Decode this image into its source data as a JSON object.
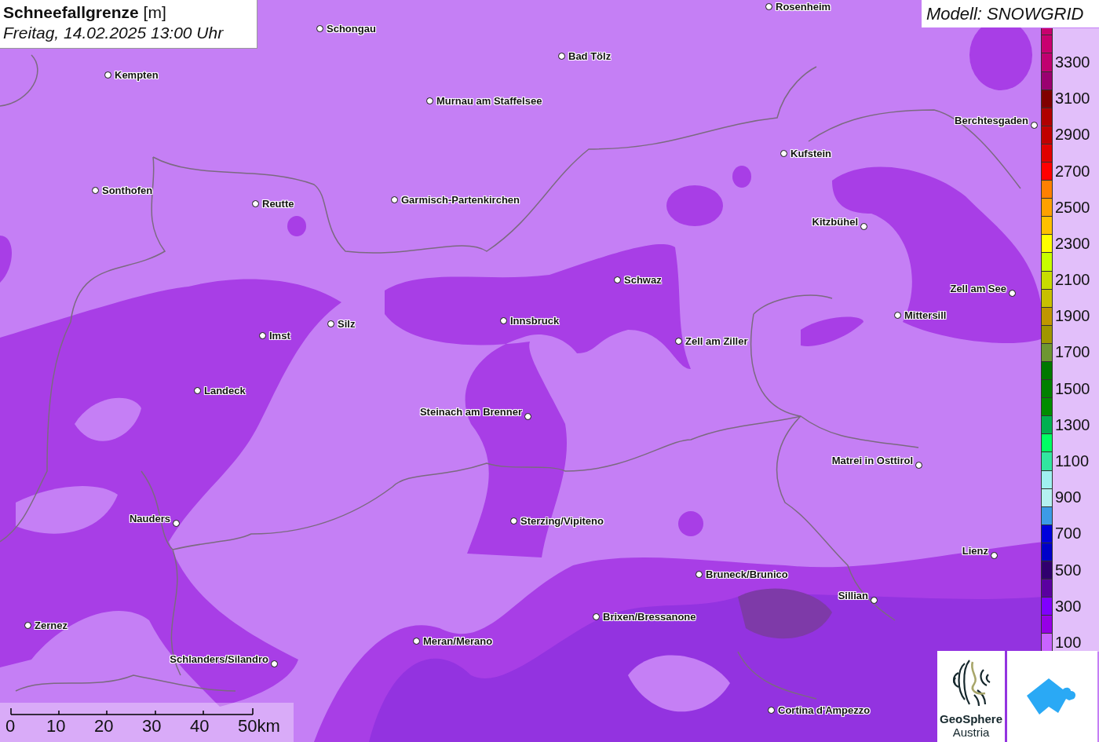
{
  "title": {
    "parameter": "Schneefallgrenze",
    "unit": "[m]",
    "datetime": "Freitag, 14.02.2025 13:00 Uhr"
  },
  "model_label": "Modell: SNOWGRID",
  "cities": [
    {
      "name": "Rosenheim"
    },
    {
      "name": "Schongau"
    },
    {
      "name": "Bad Tölz"
    },
    {
      "name": "Kempten"
    },
    {
      "name": "Murnau am Staffelsee"
    },
    {
      "name": "Berchtesgaden"
    },
    {
      "name": "Kufstein"
    },
    {
      "name": "Sonthofen"
    },
    {
      "name": "Reutte"
    },
    {
      "name": "Garmisch-Partenkirchen"
    },
    {
      "name": "Kitzbühel"
    },
    {
      "name": "Schwaz"
    },
    {
      "name": "Zell am See"
    },
    {
      "name": "Innsbruck"
    },
    {
      "name": "Silz"
    },
    {
      "name": "Mittersill"
    },
    {
      "name": "Imst"
    },
    {
      "name": "Zell am Ziller"
    },
    {
      "name": "Landeck"
    },
    {
      "name": "Steinach am Brenner"
    },
    {
      "name": "Matrei in Osttirol"
    },
    {
      "name": "Nauders"
    },
    {
      "name": "Sterzing/Vipiteno"
    },
    {
      "name": "Lienz"
    },
    {
      "name": "Bruneck/Brunico"
    },
    {
      "name": "Sillian"
    },
    {
      "name": "Brixen/Bressanone"
    },
    {
      "name": "Zernez"
    },
    {
      "name": "Meran/Merano"
    },
    {
      "name": "Schlanders/Silandro"
    },
    {
      "name": "Cortina d'Ampezzo"
    }
  ],
  "legend": {
    "bands": [
      {
        "color": "#c8006e"
      },
      {
        "color": "#c80070"
      },
      {
        "color": "#c00070",
        "label": "3300"
      },
      {
        "color": "#9a0070"
      },
      {
        "color": "#800000",
        "label": "3100"
      },
      {
        "color": "#b00000"
      },
      {
        "color": "#c00000",
        "label": "2900"
      },
      {
        "color": "#e00000"
      },
      {
        "color": "#ff0000",
        "label": "2700"
      },
      {
        "color": "#ff8000"
      },
      {
        "color": "#ffa000",
        "label": "2500"
      },
      {
        "color": "#ffc000"
      },
      {
        "color": "#ffff00",
        "label": "2300"
      },
      {
        "color": "#c8ff00"
      },
      {
        "color": "#c8dc00",
        "label": "2100"
      },
      {
        "color": "#c8c000"
      },
      {
        "color": "#c09600",
        "label": "1900"
      },
      {
        "color": "#a09600"
      },
      {
        "color": "#6e9632",
        "label": "1700"
      },
      {
        "color": "#007800"
      },
      {
        "color": "#008000",
        "label": "1500"
      },
      {
        "color": "#008c00"
      },
      {
        "color": "#00b050",
        "label": "1300"
      },
      {
        "color": "#00ff64"
      },
      {
        "color": "#32e6a0",
        "label": "1100"
      },
      {
        "color": "#a0f0f0"
      },
      {
        "color": "#b4f0f0",
        "label": "900"
      },
      {
        "color": "#3c9be6"
      },
      {
        "color": "#0000dc",
        "label": "700"
      },
      {
        "color": "#0000c8"
      },
      {
        "color": "#30006e",
        "label": "500"
      },
      {
        "color": "#5a00a0"
      },
      {
        "color": "#8000ff",
        "label": "300"
      },
      {
        "color": "#9600e6"
      },
      {
        "color": "#c864ff",
        "label": "100"
      }
    ]
  },
  "scale_bar": {
    "labels": [
      "0",
      "10",
      "20",
      "30",
      "40",
      "50km"
    ]
  },
  "logo": {
    "line_1": "GeoSphere",
    "line_2": "Austria"
  }
}
